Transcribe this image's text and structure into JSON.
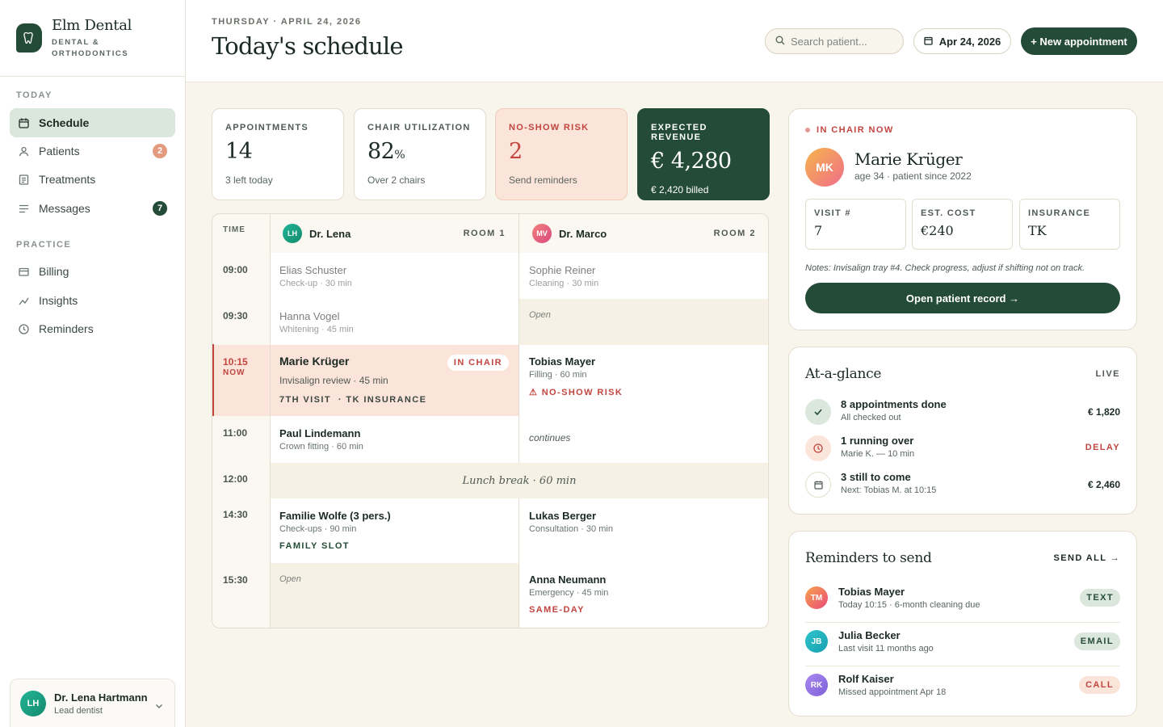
{
  "brand": {
    "name": "Elm Dental",
    "sub_line1": "DENTAL &",
    "sub_line2": "ORTHODONTICS"
  },
  "sidebar": {
    "section_today": "TODAY",
    "section_practice": "PRACTICE",
    "items": [
      {
        "label": "Schedule",
        "icon": "calendar-icon",
        "active": true
      },
      {
        "label": "Patients",
        "icon": "user-icon",
        "badge": "2"
      },
      {
        "label": "Treatments",
        "icon": "clipboard-icon"
      },
      {
        "label": "Messages",
        "icon": "message-icon",
        "badge": "7"
      },
      {
        "label": "Billing",
        "icon": "wallet-icon"
      },
      {
        "label": "Insights",
        "icon": "trend-icon"
      },
      {
        "label": "Reminders",
        "icon": "clock-icon"
      }
    ],
    "user": {
      "initials": "LH",
      "name": "Dr. Lena Hartmann",
      "role": "Lead dentist"
    }
  },
  "header": {
    "date_line": "THURSDAY · APRIL 24, 2026",
    "title": "Today's schedule",
    "search_placeholder": "Search patient...",
    "date_button": "Apr 24, 2026",
    "new_button": "+ New appointment"
  },
  "stats": [
    {
      "label": "APPOINTMENTS",
      "value": "14",
      "unit": "",
      "sub": "3 left today"
    },
    {
      "label": "CHAIR UTILIZATION",
      "value": "82",
      "unit": "%",
      "sub": "Over 2 chairs"
    },
    {
      "label": "NO-SHOW RISK",
      "value": "2",
      "unit": "",
      "sub": "Send reminders"
    },
    {
      "label": "EXPECTED REVENUE",
      "value": "€ 4,280",
      "unit": "",
      "sub": "€ 2,420 billed"
    }
  ],
  "schedule": {
    "time_header": "TIME",
    "times": [
      "09:00",
      "09:30",
      "10:15",
      "11:00",
      "12:00",
      "14:30",
      "15:30"
    ],
    "now_label": "NOW",
    "dentists": [
      {
        "initials": "LH",
        "name": "Dr. Lena",
        "room": "ROOM 1"
      },
      {
        "initials": "MV",
        "name": "Dr. Marco",
        "room": "ROOM 2"
      }
    ],
    "lena": {
      "a1": {
        "name": "Elias Schuster",
        "detail": "Check-up · 30 min"
      },
      "a2": {
        "name": "Hanna Vogel",
        "detail": "Whitening · 45 min"
      },
      "a3": {
        "name": "Marie Krüger",
        "detail": "Invisalign review · 45 min",
        "badge": "IN CHAIR",
        "tag1": "7TH VISIT",
        "tag2": "· TK INSURANCE"
      },
      "a4": {
        "name": "Paul Lindemann",
        "detail": "Crown fitting · 60 min"
      },
      "a5": {
        "name": "Familie Wolfe (3 pers.)",
        "detail": "Check-ups · 90 min",
        "tag": "FAMILY SLOT"
      },
      "a6": {
        "open": "Open"
      }
    },
    "marco": {
      "a1": {
        "name": "Sophie Reiner",
        "detail": "Cleaning · 30 min"
      },
      "a2": {
        "open": "Open"
      },
      "a3": {
        "name": "Tobias Mayer",
        "detail": "Filling · 60 min",
        "tag": "⚠ NO-SHOW RISK"
      },
      "a4": {
        "continues": "continues"
      },
      "a5": {
        "name": "Lukas Berger",
        "detail": "Consultation · 30 min"
      },
      "a6": {
        "name": "Anna Neumann",
        "detail": "Emergency · 45 min",
        "tag": "SAME-DAY"
      }
    },
    "lunch": "Lunch break · 60 min"
  },
  "in_chair": {
    "label": "IN CHAIR NOW",
    "initials": "MK",
    "name": "Marie Krüger",
    "meta": "age 34 · patient since 2022",
    "visit_label": "VISIT #",
    "visit": "7",
    "cost_label": "EST. COST",
    "cost": "€240",
    "ins_label": "INSURANCE",
    "ins": "TK",
    "notes": "Notes: Invisalign tray #4. Check progress, adjust if shifting not on track.",
    "button": "Open patient record →"
  },
  "glance": {
    "title": "At-a-glance",
    "live": "LIVE",
    "rows": [
      {
        "title": "8 appointments done",
        "sub": "All checked out",
        "value": "€ 1,820"
      },
      {
        "title": "1 running over",
        "sub": "Marie K. — 10 min",
        "value": "DELAY"
      },
      {
        "title": "3 still to come",
        "sub": "Next: Tobias M. at 10:15",
        "value": "€ 2,460"
      }
    ]
  },
  "reminders": {
    "title": "Reminders to send",
    "send_all": "SEND ALL →",
    "rows": [
      {
        "initials": "TM",
        "name": "Tobias Mayer",
        "sub": "Today 10:15 · 6-month cleaning due",
        "action": "TEXT"
      },
      {
        "initials": "JB",
        "name": "Julia Becker",
        "sub": "Last visit 11 months ago",
        "action": "EMAIL"
      },
      {
        "initials": "RK",
        "name": "Rolf Kaiser",
        "sub": "Missed appointment Apr 18",
        "action": "CALL"
      }
    ]
  },
  "colors": {
    "brand": "#244b38",
    "accent_risk": "#c2453f",
    "cream": "#f8f5ec",
    "in_chair_bg": "#fbe4d9"
  }
}
